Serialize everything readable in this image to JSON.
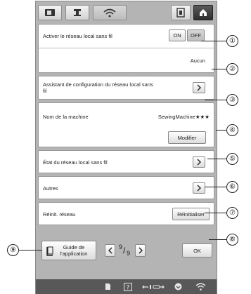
{
  "screen": {
    "accent_color": "#585858",
    "top_tabs": [
      {
        "icon": "sewing-settings-icon"
      },
      {
        "icon": "machine-settings-icon"
      },
      {
        "icon": "wifi-icon",
        "active": true
      },
      {
        "icon": "frame-icon"
      },
      {
        "icon": "home-icon"
      }
    ]
  },
  "wlan": {
    "enable_label": "Activer le réseau local sans fil",
    "on_label": "ON",
    "off_label": "OFF",
    "selected": "OFF",
    "network_value": "Aucun",
    "wizard_label": "Assistant de configuration du réseau local sans fil",
    "machine_name_label": "Nom de la machine",
    "machine_name_value": "SewingMachine★★★",
    "modify_label": "Modifier",
    "status_label": "État du réseau local sans fil",
    "others_label": "Autres",
    "reset_label": "Réinit. réseau",
    "reset_button_label": "Réinitialiser"
  },
  "footer": {
    "guide_label": "Guide de l'application",
    "page_current": "9",
    "page_total": "9",
    "ok_label": "OK"
  },
  "status_bar": {
    "icons": [
      "document-icon",
      "help-icon",
      "thread-tension-icon",
      "pressure-foot-icon",
      "wifi-icon"
    ]
  },
  "callouts": [
    "①",
    "②",
    "③",
    "④",
    "⑤",
    "⑥",
    "⑦",
    "⑧",
    "⑨"
  ]
}
